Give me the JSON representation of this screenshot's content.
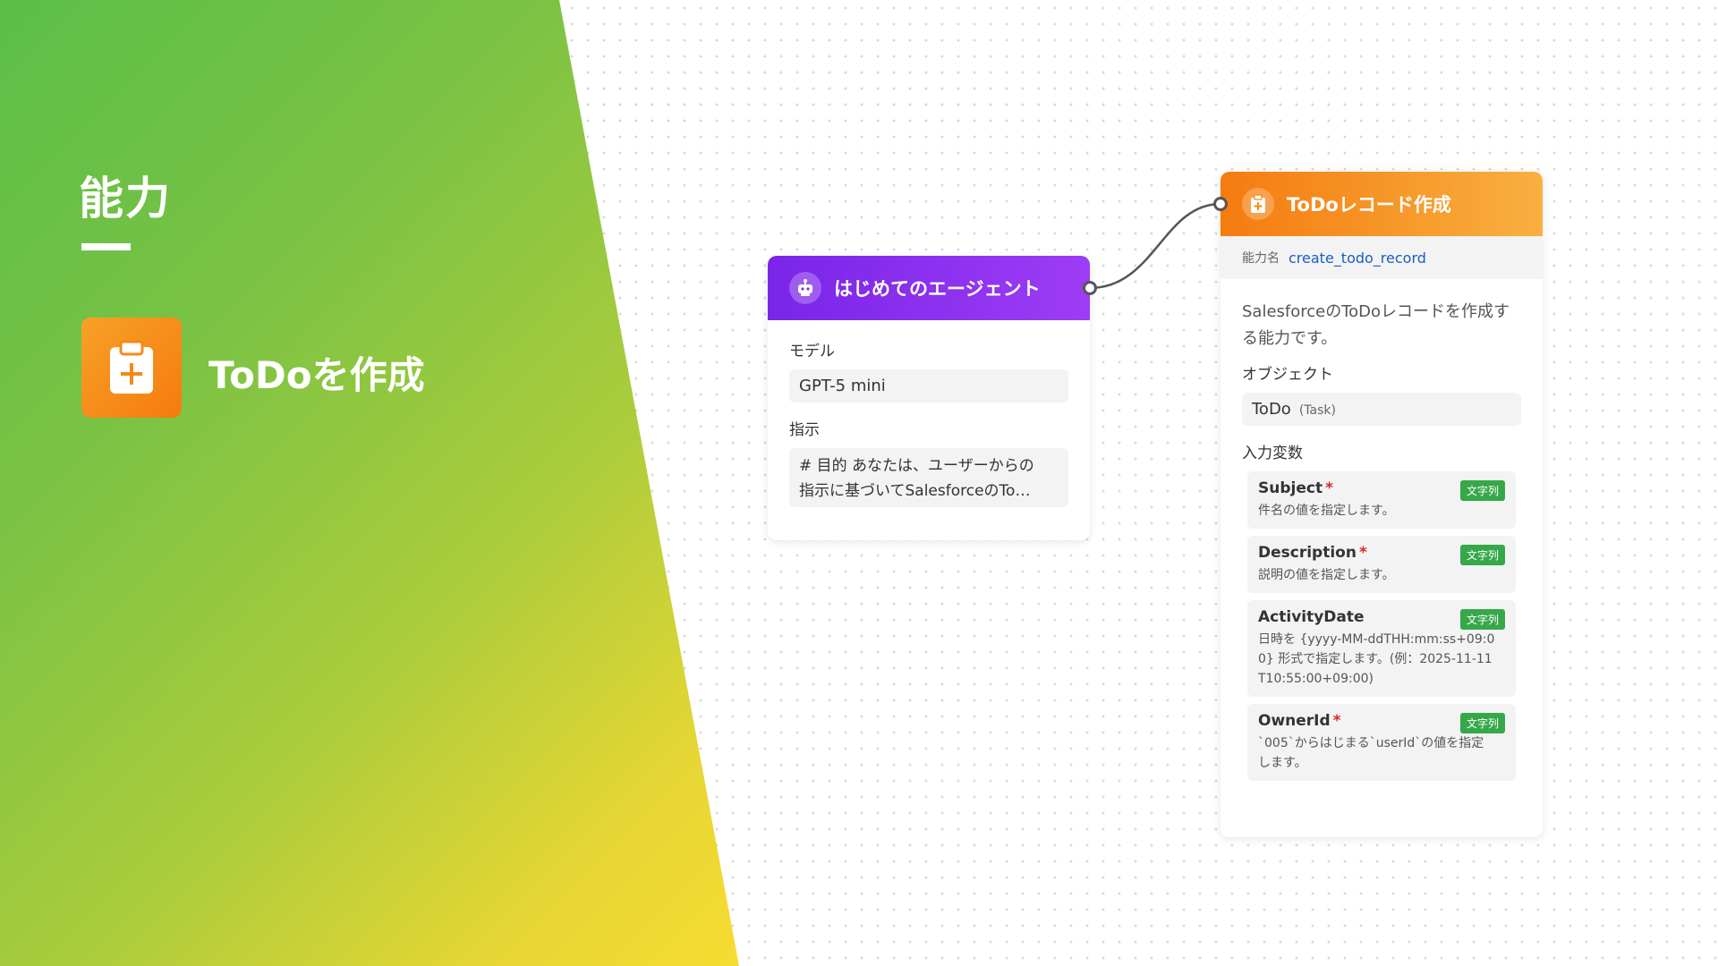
{
  "section": {
    "title": "能力"
  },
  "feature": {
    "label": "ToDoを作成",
    "icon": "clipboard-plus-icon"
  },
  "agent_node": {
    "title": "はじめてのエージェント",
    "icon": "robot-icon",
    "model_label": "モデル",
    "model_value": "GPT-5 mini",
    "instruction_label": "指示",
    "instruction_line1": "# 目的 あなたは、ユーザーからの",
    "instruction_line2": "指示に基づいてSalesforceのTo…"
  },
  "capability_node": {
    "title": "ToDoレコード作成",
    "icon": "clipboard-plus-icon",
    "name_label": "能力名",
    "name_value": "create_todo_record",
    "description": "SalesforceのToDoレコードを作成する能力です。",
    "object_label": "オブジェクト",
    "object_value": "ToDo",
    "object_api": "(Task)",
    "inputs_label": "入力変数",
    "variables": [
      {
        "name": "Subject",
        "required": "*",
        "type": "文字列",
        "desc": "件名の値を指定します。"
      },
      {
        "name": "Description",
        "required": "*",
        "type": "文字列",
        "desc": "説明の値を指定します。"
      },
      {
        "name": "ActivityDate",
        "required": "",
        "type": "文字列",
        "desc": "日時を {yyyy-MM-ddTHH:mm:ss+09:00} 形式で指定します。(例：2025-11-11T10:55:00+09:00)"
      },
      {
        "name": "OwnerId",
        "required": "*",
        "type": "文字列",
        "desc": "`005`からはじまる`userId`の値を指定します。"
      }
    ]
  },
  "colors": {
    "agent_header": "#8a30ef",
    "capability_header": "#f7941d",
    "type_badge": "#36a84a",
    "name_link": "#1a5cc4"
  }
}
